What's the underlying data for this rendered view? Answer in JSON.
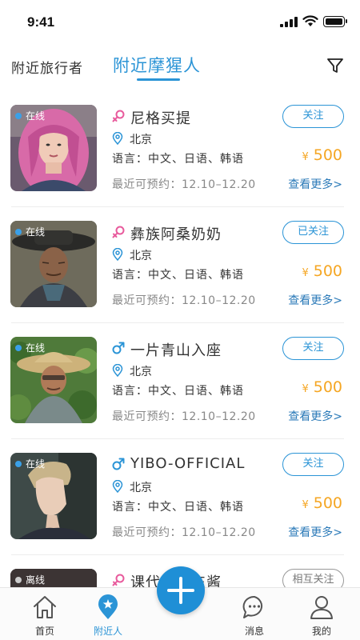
{
  "status_bar": {
    "time": "9:41"
  },
  "tabs": {
    "travelers": "附近旅行者",
    "nearby": "附近摩猩人"
  },
  "guides": [
    {
      "status": "在线",
      "name": "尼格买提",
      "gender": "female",
      "city": "北京",
      "languages": "语言：中文、日语、韩语",
      "price": "500",
      "currency": "¥",
      "availability": "最近可预约：12.10–12.20",
      "follow": "关注",
      "more": "查看更多>"
    },
    {
      "status": "在线",
      "name": "彝族阿桑奶奶",
      "gender": "female",
      "city": "北京",
      "languages": "语言：中文、日语、韩语",
      "price": "500",
      "currency": "¥",
      "availability": "最近可预约：12.10–12.20",
      "follow": "已关注",
      "more": "查看更多>"
    },
    {
      "status": "在线",
      "name": "一片青山入座",
      "gender": "male",
      "city": "北京",
      "languages": "语言：中文、日语、韩语",
      "price": "500",
      "currency": "¥",
      "availability": "最近可预约：12.10–12.20",
      "follow": "关注",
      "more": "查看更多>"
    },
    {
      "status": "在线",
      "name": "YIBO-OFFICIAL",
      "gender": "male",
      "city": "北京",
      "languages": "语言：中文、日语、韩语",
      "price": "500",
      "currency": "¥",
      "availability": "最近可预约：12.10–12.20",
      "follow": "关注",
      "more": "查看更多>"
    },
    {
      "status": "离线",
      "name": "课代表在东酱",
      "gender": "female",
      "city": "",
      "languages": "",
      "price": "",
      "currency": "",
      "availability": "",
      "follow": "相互关注",
      "more": ""
    }
  ],
  "bottom_nav": {
    "home": "首页",
    "nearby": "附近人",
    "messages": "消息",
    "mine": "我的"
  },
  "colors": {
    "accent": "#2b94d6",
    "price": "#f5a623",
    "online": "#3aa0e8",
    "offline": "#cccccc",
    "female": "#e85a9c",
    "male": "#2b94d6"
  }
}
